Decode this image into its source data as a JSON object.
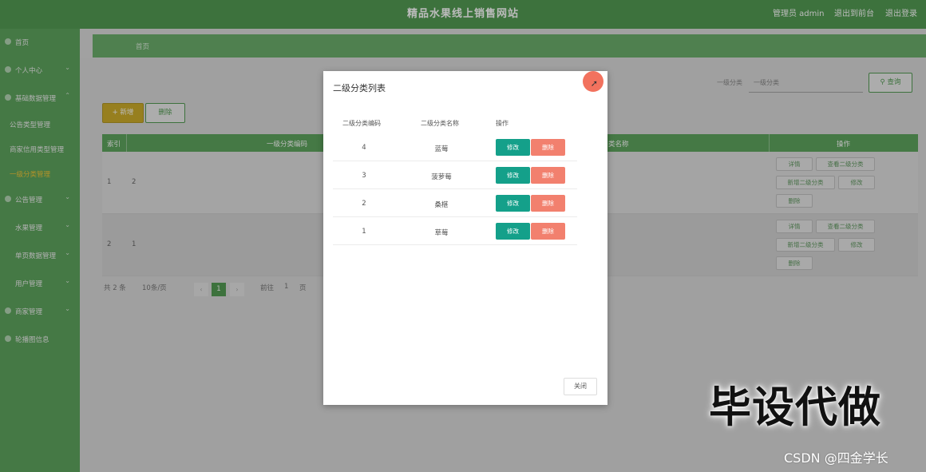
{
  "header": {
    "title": "精品水果线上销售网站",
    "user_label": "管理员 admin",
    "back_label": "退出到前台",
    "logout_label": "退出登录"
  },
  "sidebar": {
    "items": [
      {
        "label": "首页"
      },
      {
        "label": "个人中心"
      },
      {
        "label": "基础数据管理"
      },
      {
        "label": "公告类型管理"
      },
      {
        "label": "商家信用类型管理"
      },
      {
        "label": "一级分类管理"
      },
      {
        "label": "公告管理"
      },
      {
        "label": "水果管理"
      },
      {
        "label": "单页数据管理"
      },
      {
        "label": "用户管理"
      },
      {
        "label": "商家管理"
      },
      {
        "label": "轮播图信息"
      }
    ]
  },
  "breadcrumb": "首页",
  "search": {
    "label": "一级分类",
    "placeholder": "一级分类",
    "button_label": "查询"
  },
  "toolbar": {
    "add_label": "+ 新增",
    "delete_label": "删除"
  },
  "table": {
    "headers": [
      "索引",
      "一级分类编码",
      "类名称",
      "操作"
    ],
    "rows": [
      {
        "index": "1",
        "code": "2",
        "ops": [
          "详情",
          "查看二级分类",
          "新增二级分类",
          "修改",
          "删除"
        ]
      },
      {
        "index": "2",
        "code": "1",
        "ops": [
          "详情",
          "查看二级分类",
          "新增二级分类",
          "修改",
          "删除"
        ]
      }
    ]
  },
  "pager": {
    "total": "共 2 条",
    "per_page": "10条/页",
    "current": "1",
    "goto_label": "前往",
    "goto_value": "1",
    "page_suffix": "页"
  },
  "modal": {
    "title": "二级分类列表",
    "headers": [
      "二级分类编码",
      "二级分类名称",
      "操作"
    ],
    "rows": [
      {
        "code": "4",
        "name": "蓝莓"
      },
      {
        "code": "3",
        "name": "菠萝莓"
      },
      {
        "code": "2",
        "name": "桑椹"
      },
      {
        "code": "1",
        "name": "草莓"
      }
    ],
    "edit_label": "修改",
    "remove_label": "删除",
    "close_label": "关闭"
  },
  "watermark": "毕设代做",
  "csdn": "CSDN @四金学长",
  "colors": {
    "primary": "#3e8f3e",
    "edit": "#14a08a",
    "remove": "#f2806e",
    "add": "#c8a410"
  }
}
